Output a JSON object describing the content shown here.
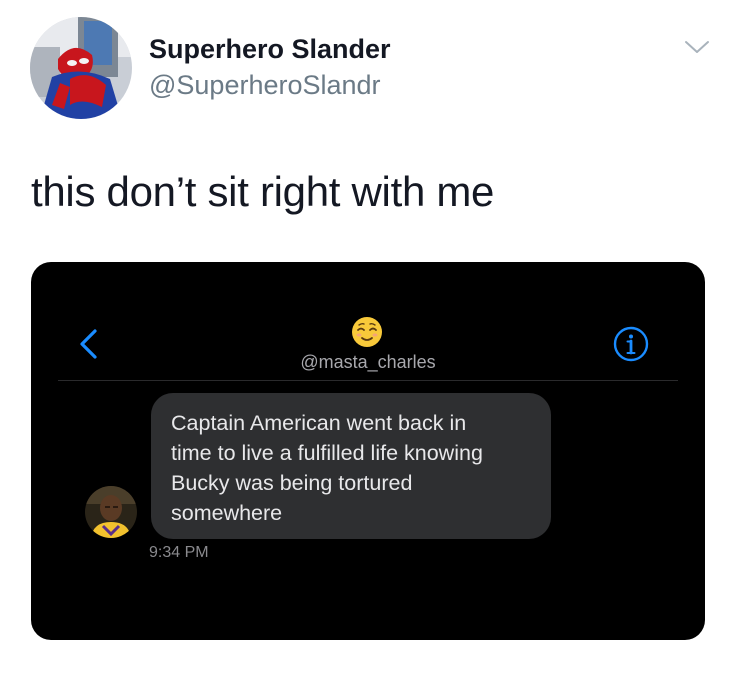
{
  "tweet": {
    "display_name": "Superhero Slander",
    "handle": "@SuperheroSlandr",
    "text": "this don’t sit right with me"
  },
  "embedded_message_screenshot": {
    "contact_handle": "@masta_charles",
    "message_lines": [
      "Captain American went back in",
      "time to live a fulfilled life knowing",
      "Bucky was being tortured",
      "somewhere"
    ],
    "timestamp": "9:34 PM"
  },
  "icons": {
    "menu": "chevron-down-icon",
    "back": "chevron-left-icon",
    "contact": "relieved-face-emoji-icon",
    "info": "info-circle-icon"
  },
  "colors": {
    "name_text": "#141823",
    "handle_text": "#6b7a86",
    "screenshot_background": "#000000",
    "bubble": "#2e2f31",
    "ios_accent": "#1a8cff"
  }
}
